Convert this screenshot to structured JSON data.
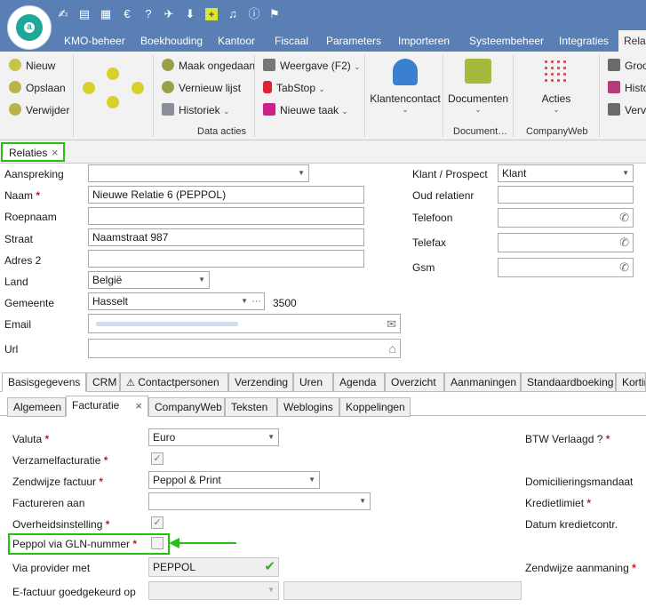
{
  "nav": {
    "tabs": [
      "KMO-beheer",
      "Boekhouding",
      "Kantoor",
      "Fiscaal",
      "Parameters",
      "Importeren",
      "Systeembeheer",
      "Integraties",
      "Rela"
    ]
  },
  "ribbon": {
    "col1": [
      "Nieuw",
      "Opslaan",
      "Verwijder"
    ],
    "col3": [
      "Maak ongedaan",
      "Vernieuw lijst",
      "Historiek"
    ],
    "col4": [
      "Weergave (F2)",
      "TabStop",
      "Nieuwe taak"
    ],
    "group_data_acties": "Data acties",
    "klantencontact": "Klantencontact",
    "documenten": "Documenten",
    "group_documenten": "Document…",
    "acties": "Acties",
    "group_companyweb": "CompanyWeb",
    "col_right": [
      "Groo",
      "Histo",
      "Verva"
    ]
  },
  "doc_tab": {
    "label": "Relaties",
    "close": "×"
  },
  "form": {
    "aanspreking_label": "Aanspreking",
    "naam_label": "Naam",
    "naam_value": "Nieuwe Relatie 6 (PEPPOL)",
    "roepnaam_label": "Roepnaam",
    "straat_label": "Straat",
    "straat_value": "Naamstraat 987",
    "adres2_label": "Adres 2",
    "land_label": "Land",
    "land_value": "België",
    "gemeente_label": "Gemeente",
    "gemeente_value": "Hasselt",
    "postcode": "3500",
    "email_label": "Email",
    "url_label": "Url",
    "klant_prospect_label": "Klant / Prospect",
    "klant_prospect_value": "Klant",
    "oud_relatienr_label": "Oud relatienr",
    "telefoon_label": "Telefoon",
    "telefax_label": "Telefax",
    "gsm_label": "Gsm",
    "required_mark": "*"
  },
  "main_tabs": [
    "Basisgegevens",
    "CRM",
    "Contactpersonen",
    "Verzending",
    "Uren",
    "Agenda",
    "Overzicht",
    "Aanmaningen",
    "Standaardboeking",
    "Kortin"
  ],
  "sub_tabs": [
    "Algemeen",
    "Facturatie",
    "CompanyWeb",
    "Teksten",
    "Weblogins",
    "Koppelingen"
  ],
  "sub_tab_close": "×",
  "facturatie": {
    "valuta_label": "Valuta",
    "valuta_value": "Euro",
    "verzamel_label": "Verzamelfacturatie",
    "zendwijze_label": "Zendwijze factuur",
    "zendwijze_value": "Peppol & Print",
    "factureren_label": "Factureren aan",
    "overheid_label": "Overheidsinstelling",
    "peppol_gln_label": "Peppol via GLN-nummer",
    "via_provider_label": "Via provider met",
    "via_provider_value": "PEPPOL",
    "efactuur_label": "E-factuur goedgekeurd op",
    "btw_label": "BTW Verlaagd ?",
    "domicilie_label": "Domicilieringsmandaat",
    "kredietlimiet_label": "Kredietlimiet",
    "datum_krediet_label": "Datum kredietcontr.",
    "zendwijze_aanmaning_label": "Zendwijze aanmaning"
  },
  "colors": {
    "titlebar": "#5a7fb5",
    "highlight_green": "#22c20e",
    "required_red": "#d11919"
  }
}
